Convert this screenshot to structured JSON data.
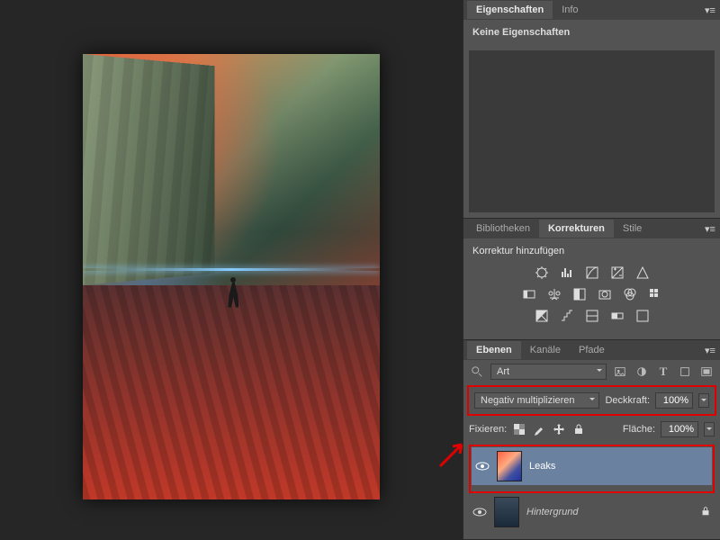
{
  "properties_panel": {
    "tabs": [
      "Eigenschaften",
      "Info"
    ],
    "active": 0,
    "message": "Keine Eigenschaften"
  },
  "adjustments_panel": {
    "tabs": [
      "Bibliotheken",
      "Korrekturen",
      "Stile"
    ],
    "active": 1,
    "header": "Korrektur hinzufügen",
    "icons": [
      [
        "brightness-contrast-icon",
        "levels-icon",
        "curves-icon",
        "exposure-icon",
        "vibrance-icon"
      ],
      [
        "hue-sat-icon",
        "color-balance-icon",
        "bw-icon",
        "photo-filter-icon",
        "channel-mixer-icon",
        "color-lookup-icon"
      ],
      [
        "invert-icon",
        "posterize-icon",
        "threshold-icon",
        "gradient-map-icon",
        "selective-color-icon"
      ]
    ]
  },
  "layers_panel": {
    "tabs": [
      "Ebenen",
      "Kanäle",
      "Pfade"
    ],
    "active": 0,
    "search_mode": "Art",
    "filter_icons": [
      "filter-image-icon",
      "filter-adjust-icon",
      "filter-type-icon",
      "filter-shape-icon",
      "filter-smart-icon"
    ],
    "blend_mode": "Negativ multiplizieren",
    "opacity_label": "Deckkraft:",
    "opacity_value": "100%",
    "lock_label": "Fixieren:",
    "lock_icons": [
      "lock-transparent-icon",
      "lock-paint-icon",
      "lock-move-icon",
      "lock-all-icon"
    ],
    "fill_label": "Fläche:",
    "fill_value": "100%",
    "layers": [
      {
        "name": "Leaks",
        "visible": true,
        "selected": true,
        "locked": false,
        "thumb": "leaks"
      },
      {
        "name": "Hintergrund",
        "visible": true,
        "selected": false,
        "locked": true,
        "thumb": "bg"
      }
    ]
  }
}
